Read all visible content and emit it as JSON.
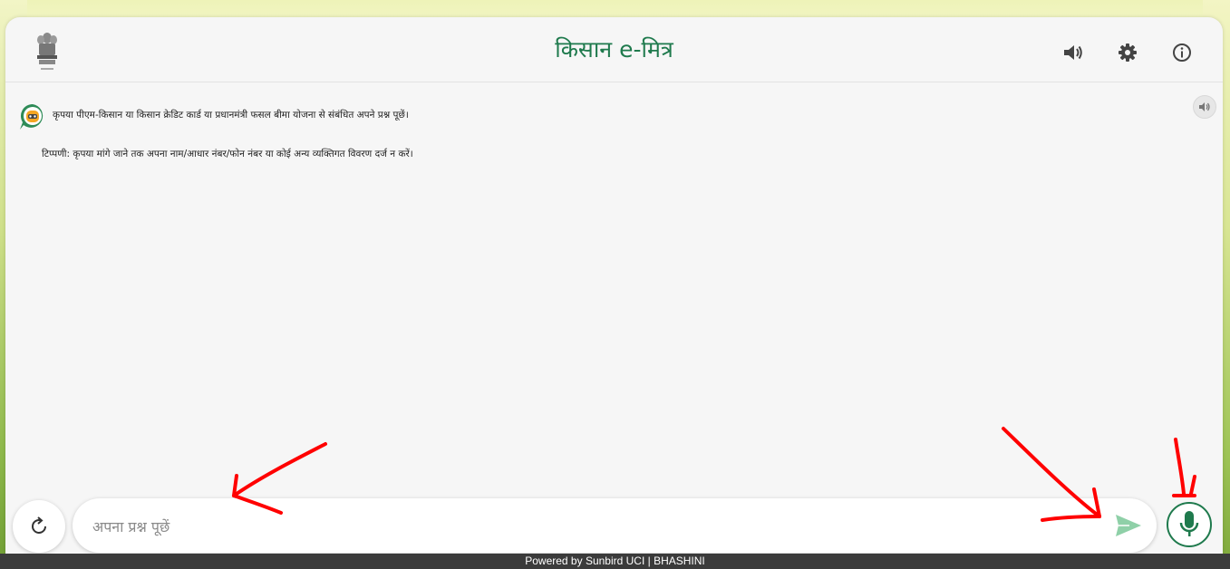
{
  "header": {
    "title": "किसान e-मित्र",
    "emblem_icon": "national-emblem-icon",
    "icons": [
      "speaker-icon",
      "gear-icon",
      "info-icon"
    ]
  },
  "chat": {
    "messages": [
      {
        "line1": "कृपया पीएम-किसान या किसान क्रेडिट कार्ड या प्रधानमंत्री फसल बीमा योजना से संबंधित अपने प्रश्न पूछें।",
        "line2": "टिप्पणी: कृपया मांगे जाने तक अपना नाम/आधार नंबर/फोन नंबर या कोई अन्य व्यक्तिगत विवरण दर्ज न करें।"
      }
    ]
  },
  "composer": {
    "placeholder": "अपना प्रश्न पूछें",
    "value": ""
  },
  "footer": {
    "text": "Powered by Sunbird UCI | BHASHINI"
  },
  "colors": {
    "brand_green": "#1f7a4d",
    "send_green": "#8fd0a8",
    "annotation_red": "#ff0000"
  }
}
